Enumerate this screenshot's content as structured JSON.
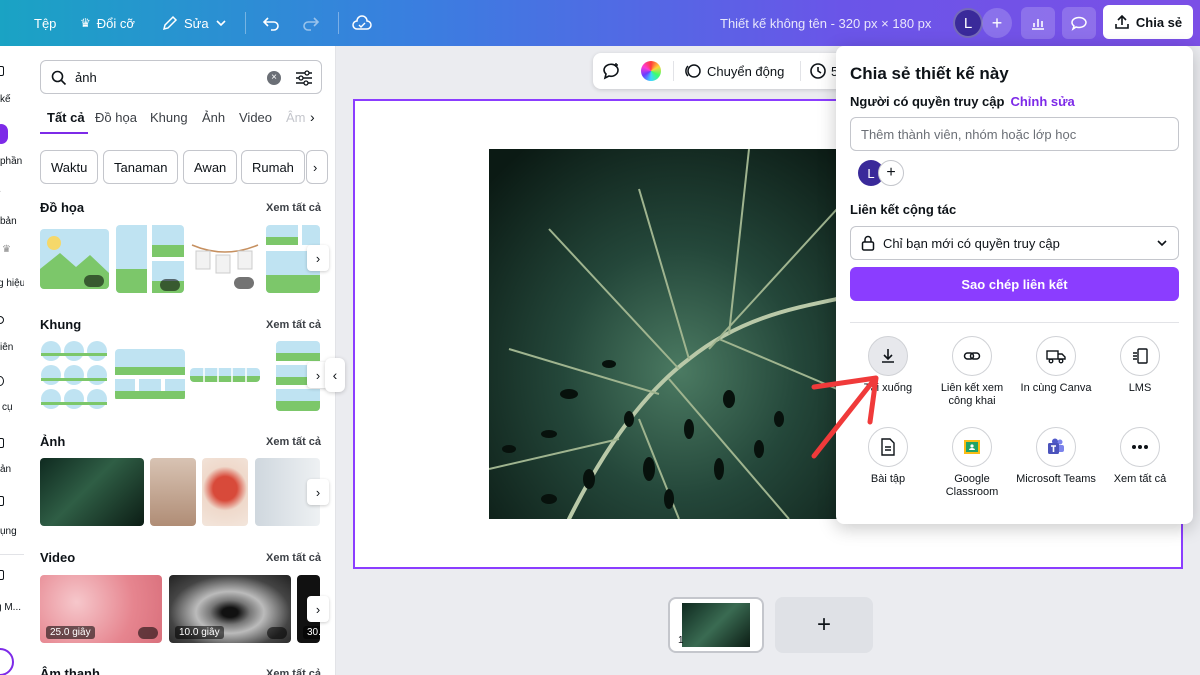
{
  "topbar": {
    "file_label": "Tệp",
    "resize_label": "Đổi cỡ",
    "edit_label": "Sửa",
    "doc_title": "Thiết kế không tên - 320 px × 180 px",
    "avatar_initial": "L",
    "share_label": "Chia sẻ",
    "gradient_start": "#1aa3c4",
    "gradient_end": "#7b4fe6"
  },
  "rail": {
    "items": [
      {
        "label": "kế",
        "icon": "layout-icon"
      },
      {
        "label": "phần",
        "icon": "elements-icon"
      },
      {
        "label": "bản",
        "icon": "text-icon"
      },
      {
        "label": "g hiệu",
        "icon": "brand-icon"
      },
      {
        "label": "iên",
        "icon": "uploads-icon"
      },
      {
        "label": "cụ",
        "icon": "tools-icon"
      },
      {
        "label": "ản",
        "icon": "projects-icon"
      },
      {
        "label": "ụng",
        "icon": "apps-icon"
      },
      {
        "label": "g M...",
        "icon": "magic-icon"
      }
    ]
  },
  "panel": {
    "search_value": "ảnh",
    "tabs": [
      "Tất cả",
      "Đồ họa",
      "Khung",
      "Ảnh",
      "Video",
      "Âm"
    ],
    "chips": [
      "Waktu",
      "Tanaman",
      "Awan",
      "Rumah"
    ],
    "see_all": "Xem tất cả",
    "sections": {
      "graphics": "Đồ họa",
      "frames": "Khung",
      "photos": "Ảnh",
      "videos": "Video",
      "audio": "Âm thanh"
    },
    "video_durations": [
      "25.0 giây",
      "10.0 giây",
      "30."
    ]
  },
  "context_bar": {
    "animate_label": "Chuyển động",
    "timer_partial": "5"
  },
  "pages": {
    "page_number": "1",
    "add_symbol": "+"
  },
  "share": {
    "title": "Chia sẻ thiết kế này",
    "access_label": "Người có quyền truy cập",
    "edit_link": "Chỉnh sửa",
    "invite_placeholder": "Thêm thành viên, nhóm hoặc lớp học",
    "member_initial": "L",
    "collab_label": "Liên kết cộng tác",
    "access_option": "Chỉ bạn mới có quyền truy cập",
    "copy_link": "Sao chép liên kết",
    "options": [
      {
        "label": "Tải xuống",
        "icon": "download-icon"
      },
      {
        "label": "Liên kết xem công khai",
        "icon": "link-icon"
      },
      {
        "label": "In cùng Canva",
        "icon": "truck-icon"
      },
      {
        "label": "LMS",
        "icon": "lms-icon"
      },
      {
        "label": "Bài tập",
        "icon": "document-icon"
      },
      {
        "label": "Google Classroom",
        "icon": "google-classroom-icon"
      },
      {
        "label": "Microsoft Teams",
        "icon": "teams-icon"
      },
      {
        "label": "Xem tất cả",
        "icon": "more-icon"
      }
    ],
    "accent_color": "#8b3dff"
  }
}
